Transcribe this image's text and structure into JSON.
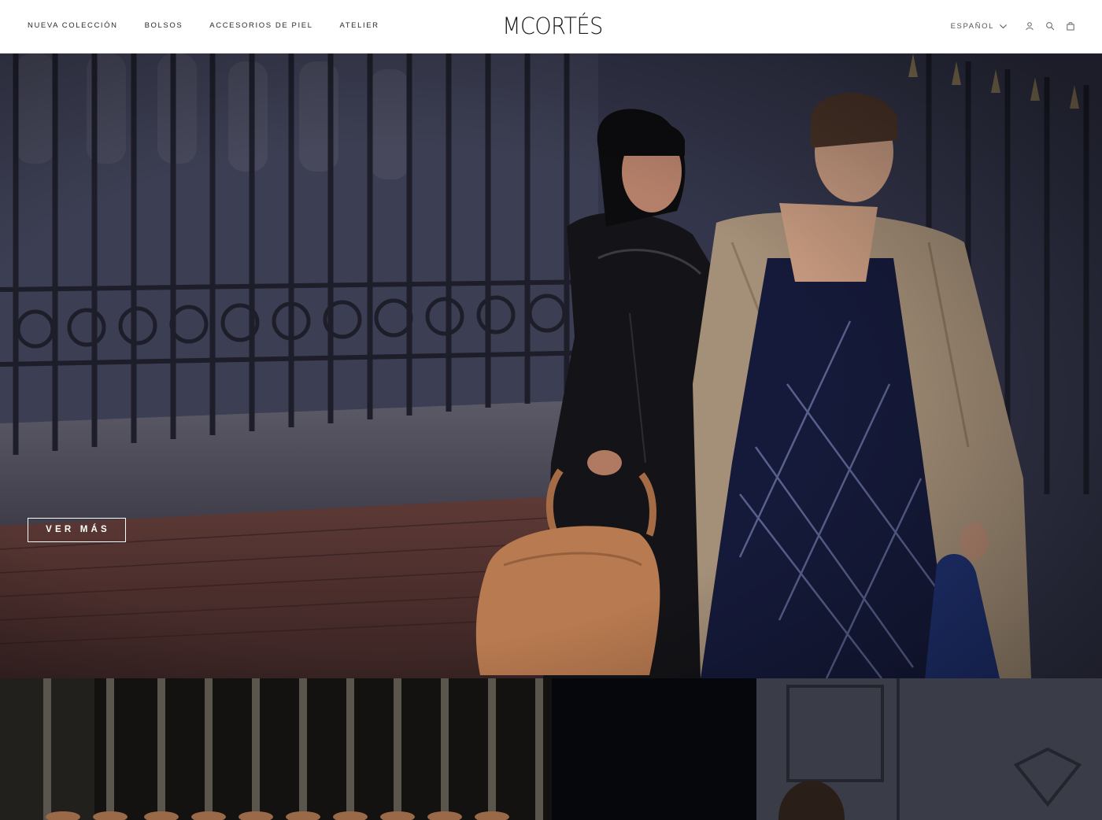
{
  "header": {
    "nav": [
      {
        "label": "NUEVA COLECCIÓN"
      },
      {
        "label": "BOLSOS"
      },
      {
        "label": "ACCESORIOS DE PIEL"
      },
      {
        "label": "ATELIER"
      }
    ],
    "logo": "MCORTÉS",
    "language": "ESPAÑOL",
    "icons": [
      "account-icon",
      "search-icon",
      "bag-icon"
    ]
  },
  "hero": {
    "cta_label": "VER MÁS"
  },
  "colors": {
    "header_bg": "#ffffff",
    "text": "#2b2b2b",
    "cta_border": "#ffffff"
  }
}
